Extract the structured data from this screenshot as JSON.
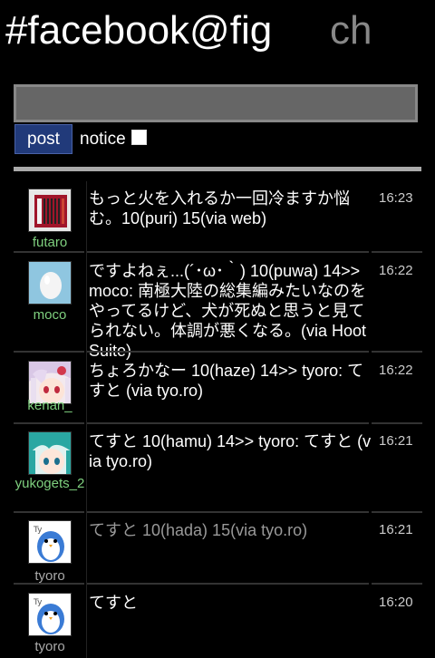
{
  "header": {
    "title": "#facebook@fig",
    "ch": "ch"
  },
  "compose": {
    "post_label": "post",
    "notice_label": "notice",
    "notice_checked": false
  },
  "timeline": [
    {
      "user": "futaro",
      "avatar_icon": "accordion-avatar-icon",
      "text": "もっと火を入れるか一回冷ますか悩む。10(puri) 15(via web)",
      "time": "16:23"
    },
    {
      "user": "moco",
      "avatar_icon": "egg-avatar-icon",
      "text": "ですよねぇ...(´･ω･｀) 10(puwa) 14>> moco: 南極大陸の総集編みたいなのをやってるけど、犬が死ぬと思うと見てられない。体調が悪くなる。(via HootSuite)",
      "time": "16:22"
    },
    {
      "user": "kenan_",
      "avatar_icon": "anime-girl-avatar-icon",
      "text": "ちょろかなー 10(haze) 14>> tyoro: てすと (via tyo.ro)",
      "time": "16:22"
    },
    {
      "user": "yukogets_2",
      "avatar_icon": "anime-teal-hair-avatar-icon",
      "text": "てすと 10(hamu) 14>> tyoro: てすと (via tyo.ro)",
      "time": "16:21"
    },
    {
      "user": "tyoro",
      "avatar_icon": "penguin-avatar-icon",
      "text": "てすと 10(hada) 15(via tyo.ro)",
      "time": "16:21"
    },
    {
      "user": "tyoro",
      "avatar_icon": "penguin-avatar-icon",
      "text": "てすと",
      "time": "16:20"
    }
  ],
  "colors": {
    "post_button": "#213a7a",
    "username_green": "#7fd07f",
    "username_gray": "#aaaaaa"
  }
}
